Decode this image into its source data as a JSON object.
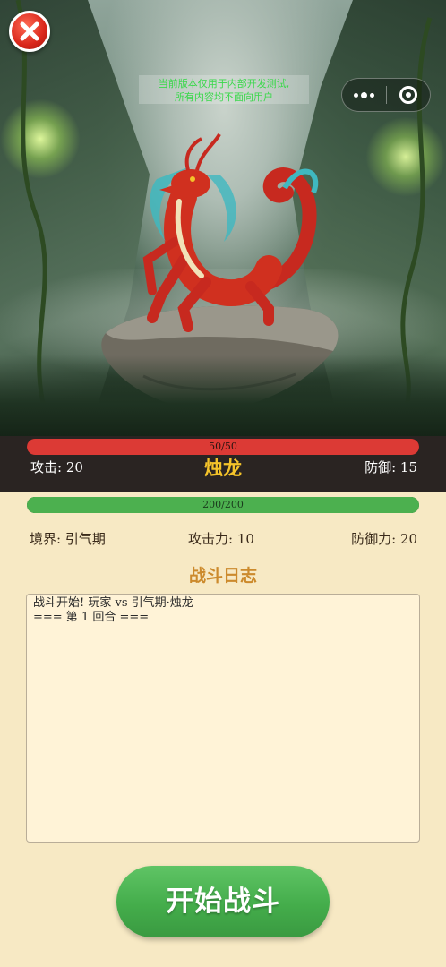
{
  "notice": {
    "line1": "当前版本仅用于内部开发测试,",
    "line2": "所有内容均不面向用户"
  },
  "icons": {
    "close": "close-icon",
    "more": "more-dots-icon",
    "target": "target-icon"
  },
  "enemy": {
    "name": "烛龙",
    "hp_text": "50/50",
    "hp_fraction": 1.0,
    "attack_text": "攻击: 20",
    "defense_text": "防御: 15"
  },
  "player": {
    "hp_text": "200/200",
    "hp_fraction": 1.0,
    "realm_text": "境界: 引气期",
    "attack_text": "攻击力: 10",
    "defense_text": "防御力: 20"
  },
  "battle_log": {
    "title": "战斗日志",
    "lines": [
      "战斗开始! 玩家 vs 引气期·烛龙",
      "=== 第 1 回合 ==="
    ]
  },
  "start_button": {
    "label": "开始战斗"
  },
  "colors": {
    "enemy_hp": "#dc3a35",
    "player_hp": "#4cb04f",
    "enemy_name": "#f4c32a",
    "log_title": "#cc8a2c",
    "button": "#44ad4b",
    "background": "#f7e9c4"
  }
}
